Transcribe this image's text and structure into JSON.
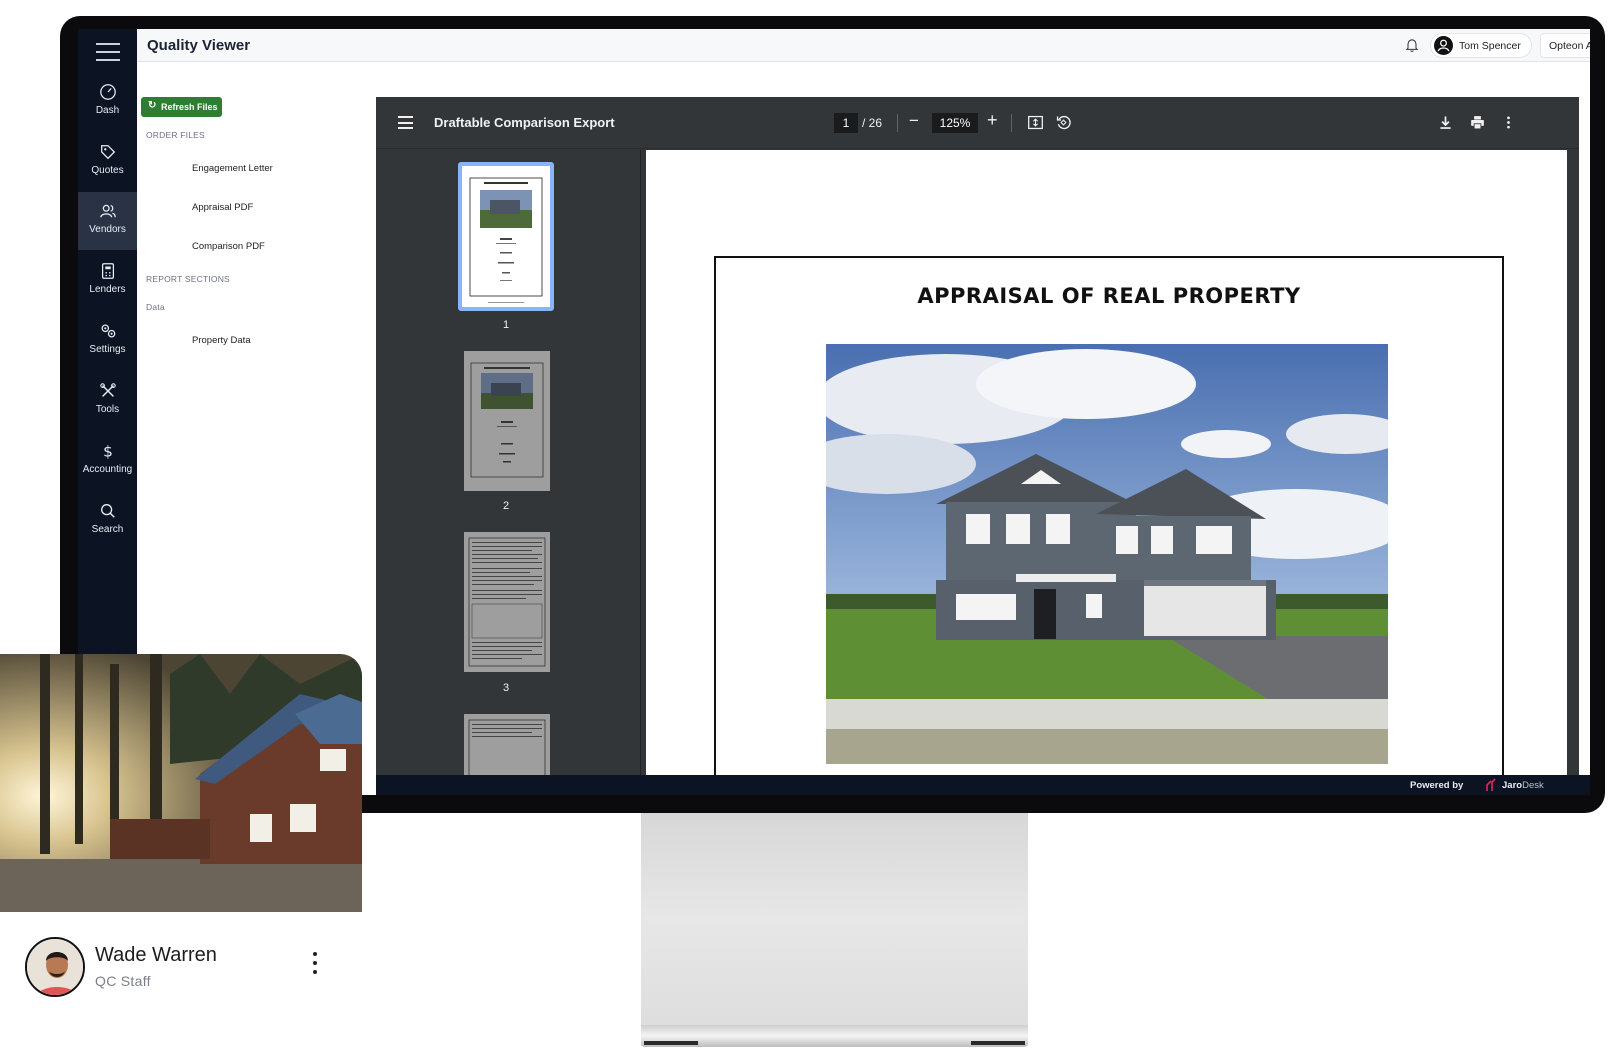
{
  "app": {
    "title": "Quality Viewer",
    "user_name": "Tom Spencer",
    "organization": "Opteon Appraisal Inc"
  },
  "nav": {
    "items": [
      {
        "label": "Dash",
        "icon": "dashboard-gauge-icon"
      },
      {
        "label": "Quotes",
        "icon": "tag-icon"
      },
      {
        "label": "Vendors",
        "icon": "users-icon",
        "active": true
      },
      {
        "label": "Lenders",
        "icon": "calculator-icon"
      },
      {
        "label": "Settings",
        "icon": "gears-icon"
      },
      {
        "label": "Tools",
        "icon": "tools-icon"
      },
      {
        "label": "Accounting",
        "icon": "dollar-icon"
      },
      {
        "label": "Search",
        "icon": "search-icon"
      }
    ]
  },
  "files": {
    "refresh_label": "Refresh Files",
    "order_files_header": "ORDER FILES",
    "order_files": [
      "Engagement Letter",
      "Appraisal PDF",
      "Comparison PDF"
    ],
    "report_sections_header": "REPORT SECTIONS",
    "data_group": "Data",
    "report_items": [
      "Property Data"
    ]
  },
  "viewer": {
    "document_title": "Draftable Comparison Export",
    "current_page": "1",
    "total_pages": "/ 26",
    "zoom": "125%",
    "thumbnails": [
      "1",
      "2",
      "3"
    ],
    "page_heading": "APPRAISAL OF REAL PROPERTY"
  },
  "footer": {
    "powered_by": "Powered by",
    "brand_bold": "Jaro",
    "brand_light": "Desk"
  },
  "profile_card": {
    "name": "Wade Warren",
    "role": "QC Staff"
  },
  "colors": {
    "nav_bg": "#0c1424",
    "accent_green": "#2e7d32",
    "viewer_bg": "#323639",
    "thumb_selected": "#8ab4f8",
    "brand_pink": "#e0245e"
  }
}
